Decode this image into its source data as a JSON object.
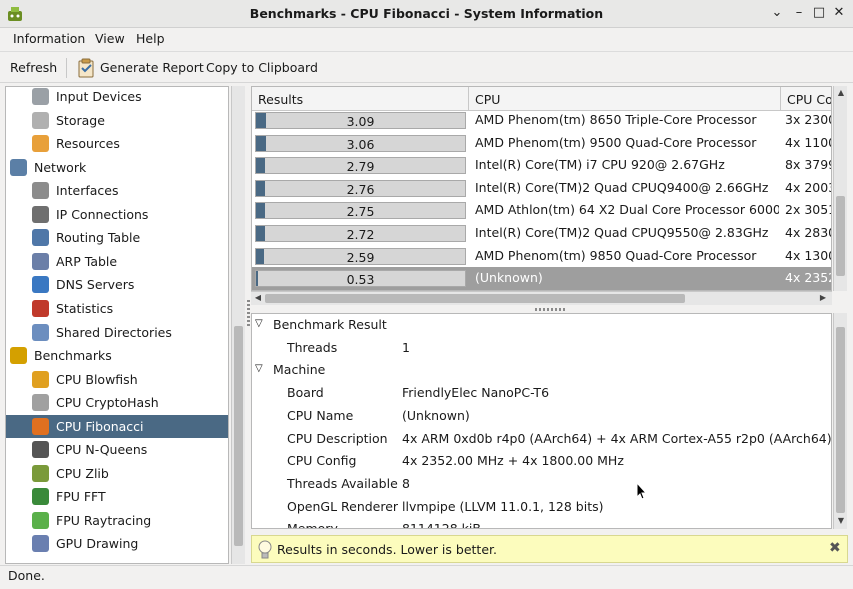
{
  "window": {
    "title": "Benchmarks - CPU Fibonacci - System Information"
  },
  "menu": [
    "Information",
    "View",
    "Help"
  ],
  "toolbar": {
    "refresh": "Refresh",
    "generate_report": "Generate Report",
    "copy": "Copy to Clipboard"
  },
  "sidebar": {
    "items": [
      {
        "label": "Input Devices",
        "icon": "keyboard-icon",
        "level": 2
      },
      {
        "label": "Storage",
        "icon": "disk-icon",
        "level": 2
      },
      {
        "label": "Resources",
        "icon": "resources-icon",
        "level": 2
      },
      {
        "label": "Network",
        "icon": "network-icon",
        "level": 1
      },
      {
        "label": "Interfaces",
        "icon": "interfaces-icon",
        "level": 2
      },
      {
        "label": "IP Connections",
        "icon": "connections-icon",
        "level": 2
      },
      {
        "label": "Routing Table",
        "icon": "routing-icon",
        "level": 2
      },
      {
        "label": "ARP Table",
        "icon": "arp-icon",
        "level": 2
      },
      {
        "label": "DNS Servers",
        "icon": "dns-icon",
        "level": 2
      },
      {
        "label": "Statistics",
        "icon": "statistics-icon",
        "level": 2
      },
      {
        "label": "Shared Directories",
        "icon": "folder-icon",
        "level": 2
      },
      {
        "label": "Benchmarks",
        "icon": "benchmarks-icon",
        "level": 1
      },
      {
        "label": "CPU Blowfish",
        "icon": "blowfish-icon",
        "level": 2
      },
      {
        "label": "CPU CryptoHash",
        "icon": "key-icon",
        "level": 2
      },
      {
        "label": "CPU Fibonacci",
        "icon": "fibonacci-icon",
        "level": 2,
        "selected": true
      },
      {
        "label": "CPU N-Queens",
        "icon": "chess-icon",
        "level": 2
      },
      {
        "label": "CPU Zlib",
        "icon": "zlib-icon",
        "level": 2
      },
      {
        "label": "FPU FFT",
        "icon": "fft-icon",
        "level": 2
      },
      {
        "label": "FPU Raytracing",
        "icon": "raytracing-icon",
        "level": 2
      },
      {
        "label": "GPU Drawing",
        "icon": "gpu-icon",
        "level": 2
      }
    ]
  },
  "results": {
    "columns": [
      "Results",
      "CPU",
      "CPU Co"
    ],
    "max_value": 3.09,
    "rows": [
      {
        "value": "3.09",
        "cpu": "AMD Phenom(tm) 8650 Triple-Core Processor",
        "config": "3x 2300"
      },
      {
        "value": "3.06",
        "cpu": "AMD Phenom(tm) 9500 Quad-Core Processor",
        "config": "4x 1100"
      },
      {
        "value": "2.79",
        "cpu": "Intel(R) Core(TM) i7 CPU 920@ 2.67GHz",
        "config": "8x 3799"
      },
      {
        "value": "2.76",
        "cpu": "Intel(R) Core(TM)2 Quad CPUQ9400@ 2.66GHz",
        "config": "4x 2003"
      },
      {
        "value": "2.75",
        "cpu": "AMD Athlon(tm) 64 X2 Dual Core Processor 6000+",
        "config": "2x 3051"
      },
      {
        "value": "2.72",
        "cpu": "Intel(R) Core(TM)2 Quad CPUQ9550@ 2.83GHz",
        "config": "4x 2830"
      },
      {
        "value": "2.59",
        "cpu": "AMD Phenom(tm) 9850 Quad-Core Processor",
        "config": "4x 1300"
      },
      {
        "value": "0.53",
        "cpu": "(Unknown)",
        "config": "4x 2352",
        "selected": true
      }
    ]
  },
  "details": {
    "sections": [
      {
        "title": "Benchmark Result",
        "rows": [
          {
            "key": "Threads",
            "value": "1"
          }
        ]
      },
      {
        "title": "Machine",
        "rows": [
          {
            "key": "Board",
            "value": "FriendlyElec NanoPC-T6"
          },
          {
            "key": "CPU Name",
            "value": "(Unknown)"
          },
          {
            "key": "CPU Description",
            "value": "4x ARM 0xd0b r4p0 (AArch64) + 4x ARM Cortex-A55 r2p0 (AArch64)"
          },
          {
            "key": "CPU Config",
            "value": "4x 2352.00 MHz + 4x 1800.00 MHz"
          },
          {
            "key": "Threads Available",
            "value": "8"
          },
          {
            "key": "OpenGL Renderer",
            "value": "llvmpipe (LLVM 11.0.1, 128 bits)"
          },
          {
            "key": "Memory",
            "value": "8114128 kiB"
          }
        ]
      }
    ]
  },
  "infobar": {
    "message": "Results in seconds. Lower is better."
  },
  "status": {
    "text": "Done."
  },
  "colors": {
    "selection": "#4a6984",
    "bar": "#4a6984",
    "info": "#fcfcbd"
  }
}
